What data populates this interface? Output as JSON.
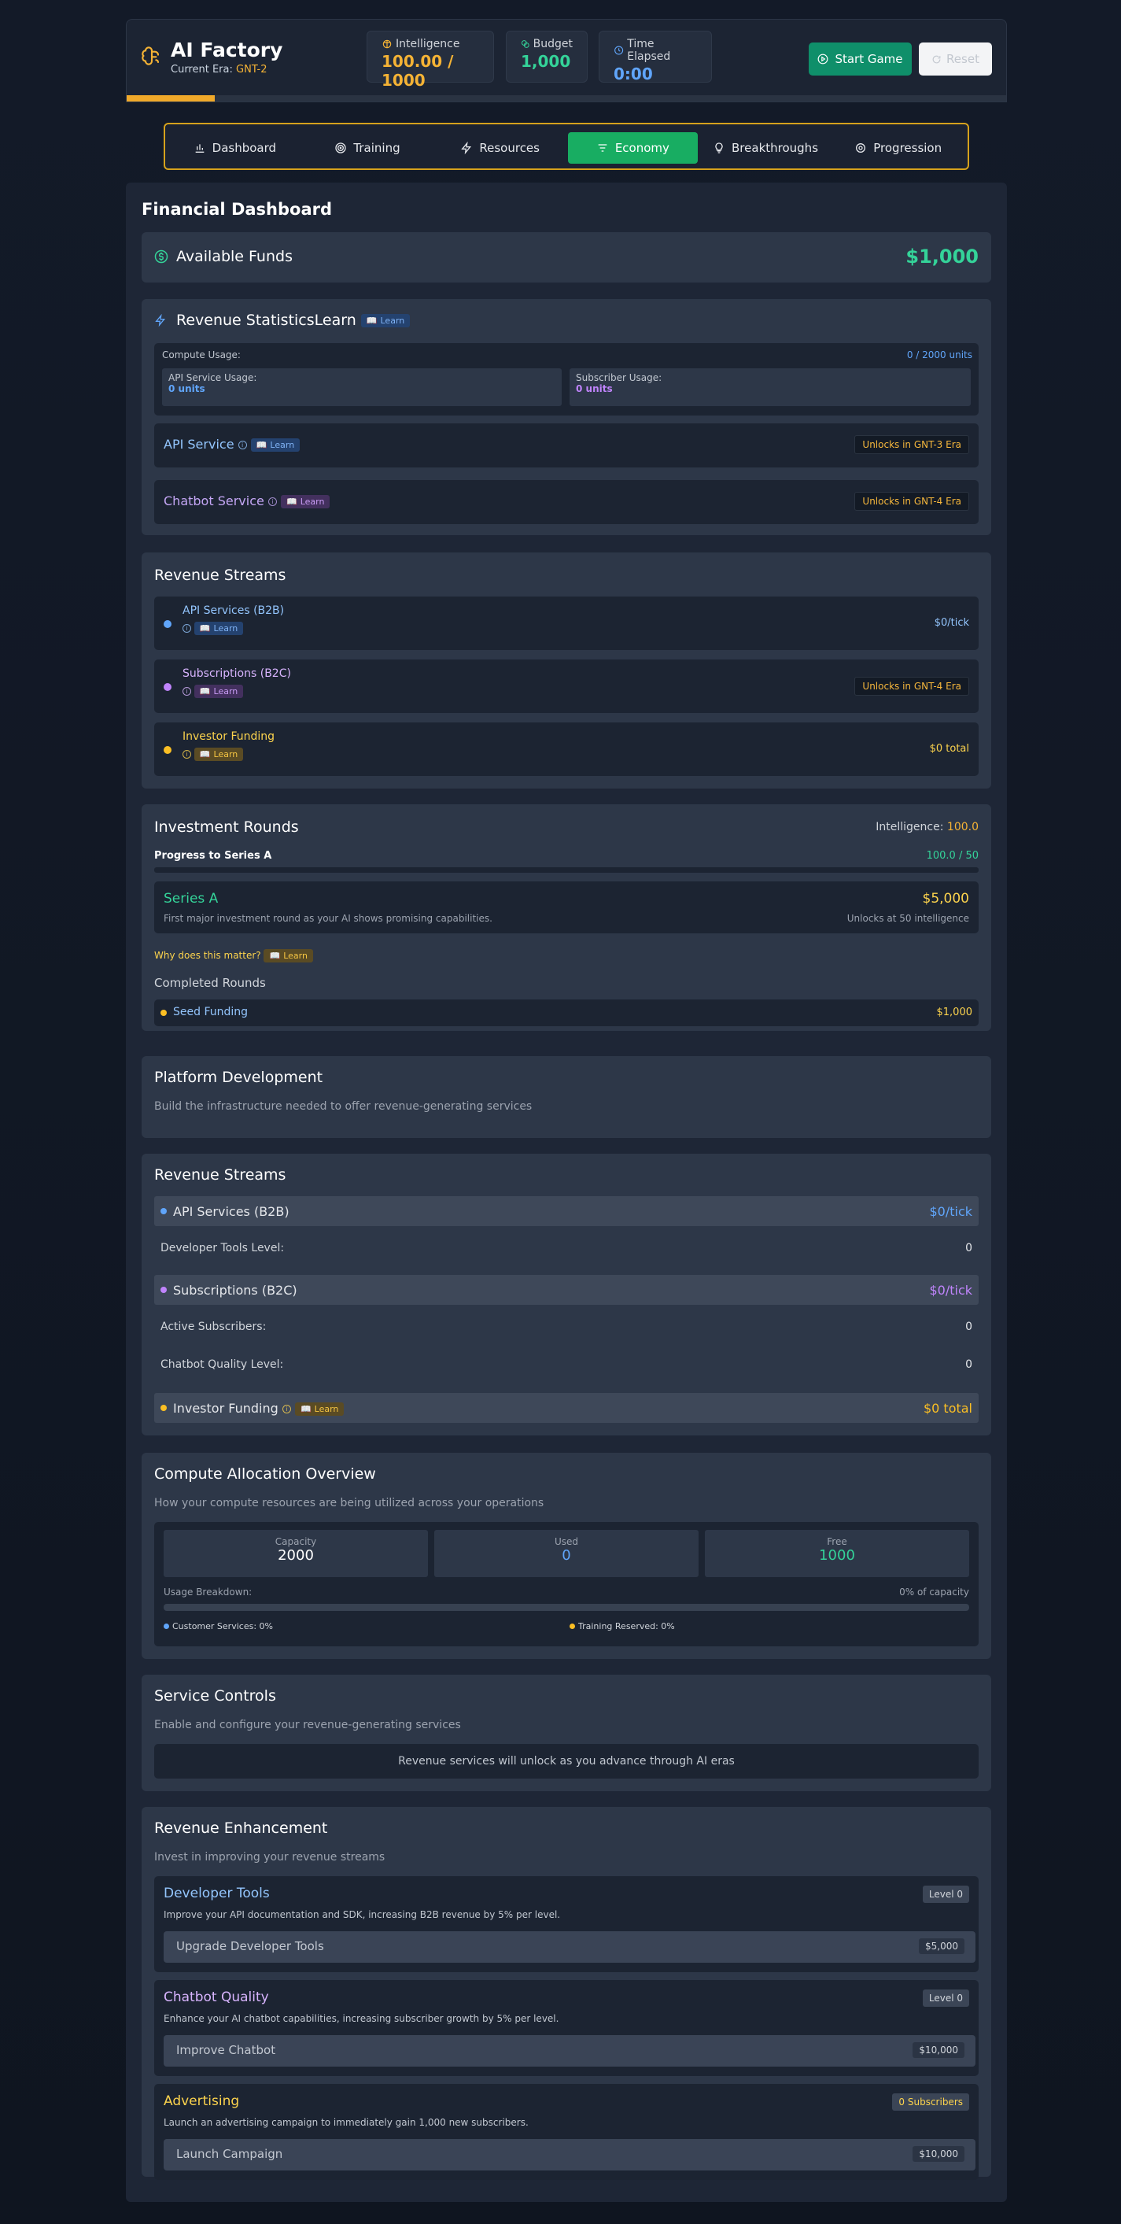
{
  "header": {
    "title": "AI Factory",
    "era_label": "Current Era:",
    "era_value": "GNT-2",
    "stats": {
      "intelligence": {
        "label": "Intelligence",
        "value": "100.00 / 1000"
      },
      "budget": {
        "label": "Budget",
        "value": "1,000"
      },
      "time": {
        "label": "Time Elapsed",
        "value": "0:00"
      }
    },
    "start_label": "Start Game",
    "reset_label": "Reset",
    "era_progress_fraction": 0.1
  },
  "tabs": [
    {
      "label": "Dashboard",
      "icon": "bar-chart-icon"
    },
    {
      "label": "Training",
      "icon": "target-icon"
    },
    {
      "label": "Resources",
      "icon": "lightning-icon"
    },
    {
      "label": "Economy",
      "icon": "menu-lines-icon",
      "active": true
    },
    {
      "label": "Breakthroughs",
      "icon": "lightbulb-icon"
    },
    {
      "label": "Progression",
      "icon": "gear-icon"
    }
  ],
  "main": {
    "title": "Financial Dashboard",
    "funds": {
      "label": "Available Funds",
      "value": "$1,000"
    },
    "revenue_stats": {
      "title": "Revenue StatisticsLearn",
      "learn": "Learn",
      "compute_usage_label": "Compute Usage:",
      "compute_usage_value": "0 / 2000 units",
      "api_usage_label": "API Service Usage:",
      "api_usage_value": "0 units",
      "subscriber_usage_label": "Subscriber Usage:",
      "subscriber_usage_value": "0 units",
      "api_service": {
        "label": "API Service",
        "learn": "Learn",
        "unlock": "Unlocks in GNT-3 Era"
      },
      "chatbot_service": {
        "label": "Chatbot Service",
        "learn": "Learn",
        "unlock": "Unlocks in GNT-4 Era"
      }
    },
    "revenue_streams_a": {
      "title": "Revenue Streams",
      "items": [
        {
          "name": "API Services (B2B)",
          "learn": "Learn",
          "value": "$0/tick"
        },
        {
          "name": "Subscriptions (B2C)",
          "learn": "Learn",
          "value": "Unlocks in GNT-4 Era"
        },
        {
          "name": "Investor Funding",
          "learn": "Learn",
          "value": "$0 total"
        }
      ]
    },
    "investment": {
      "title": "Investment Rounds",
      "intelligence_label": "Intelligence:",
      "intelligence_value": "100.0",
      "progress_label": "Progress to Series A",
      "progress_value": "100.0 / 50",
      "progress_fraction": 1.0,
      "series_name": "Series A",
      "series_amount": "$5,000",
      "series_desc": "First major investment round as your AI shows promising capabilities.",
      "series_unlock": "Unlocks at 50 intelligence",
      "why_label": "Why does this matter?",
      "why_learn": "Learn",
      "completed_label": "Completed Rounds",
      "completed": {
        "name": "Seed Funding",
        "value": "$1,000"
      }
    },
    "platform": {
      "title": "Platform Development",
      "desc": "Build the infrastructure needed to offer revenue-generating services"
    },
    "revenue_streams_b": {
      "title": "Revenue Streams",
      "api": {
        "name": "API Services (B2B)",
        "value": "$0/tick"
      },
      "dev_tools": {
        "label": "Developer Tools Level:",
        "value": "0"
      },
      "subs": {
        "name": "Subscriptions (B2C)",
        "value": "$0/tick"
      },
      "active_subs": {
        "label": "Active Subscribers:",
        "value": "0"
      },
      "chatbot_quality": {
        "label": "Chatbot Quality Level:",
        "value": "0"
      },
      "investor": {
        "name": "Investor Funding",
        "learn": "Learn",
        "value": "$0 total"
      }
    },
    "compute": {
      "title": "Compute Allocation Overview",
      "desc": "How your compute resources are being utilized across your operations",
      "capacity_label": "Capacity",
      "capacity_value": "2000",
      "used_label": "Used",
      "used_value": "0",
      "free_label": "Free",
      "free_value": "1000",
      "breakdown_label": "Usage Breakdown:",
      "breakdown_value": "0% of capacity",
      "usage_fraction": 0,
      "customer_label": "Customer Services: 0%",
      "training_label": "Training Reserved: 0%"
    },
    "service_controls": {
      "title": "Service Controls",
      "desc": "Enable and configure your revenue-generating services",
      "notice": "Revenue services will unlock as you advance through AI eras"
    },
    "enhancement": {
      "title": "Revenue Enhancement",
      "desc": "Invest in improving your revenue streams",
      "items": [
        {
          "name": "Developer Tools",
          "badge": "Level 0",
          "desc": "Improve your API documentation and SDK, increasing B2B revenue by 5% per level.",
          "button": "Upgrade Developer Tools",
          "price": "$5,000"
        },
        {
          "name": "Chatbot Quality",
          "badge": "Level 0",
          "desc": "Enhance your AI chatbot capabilities, increasing subscriber growth by 5% per level.",
          "button": "Improve Chatbot",
          "price": "$10,000"
        },
        {
          "name": "Advertising",
          "badge": "0 Subscribers",
          "desc": "Launch an advertising campaign to immediately gain 1,000 new subscribers.",
          "button": "Launch Campaign",
          "price": "$10,000"
        }
      ]
    }
  },
  "colors": {
    "accent_green": "#18ad62",
    "gold": "#f5b335",
    "blue": "#60a5fa",
    "purple": "#c084fc",
    "yellow": "#fbbf24",
    "green_text": "#34d399"
  }
}
